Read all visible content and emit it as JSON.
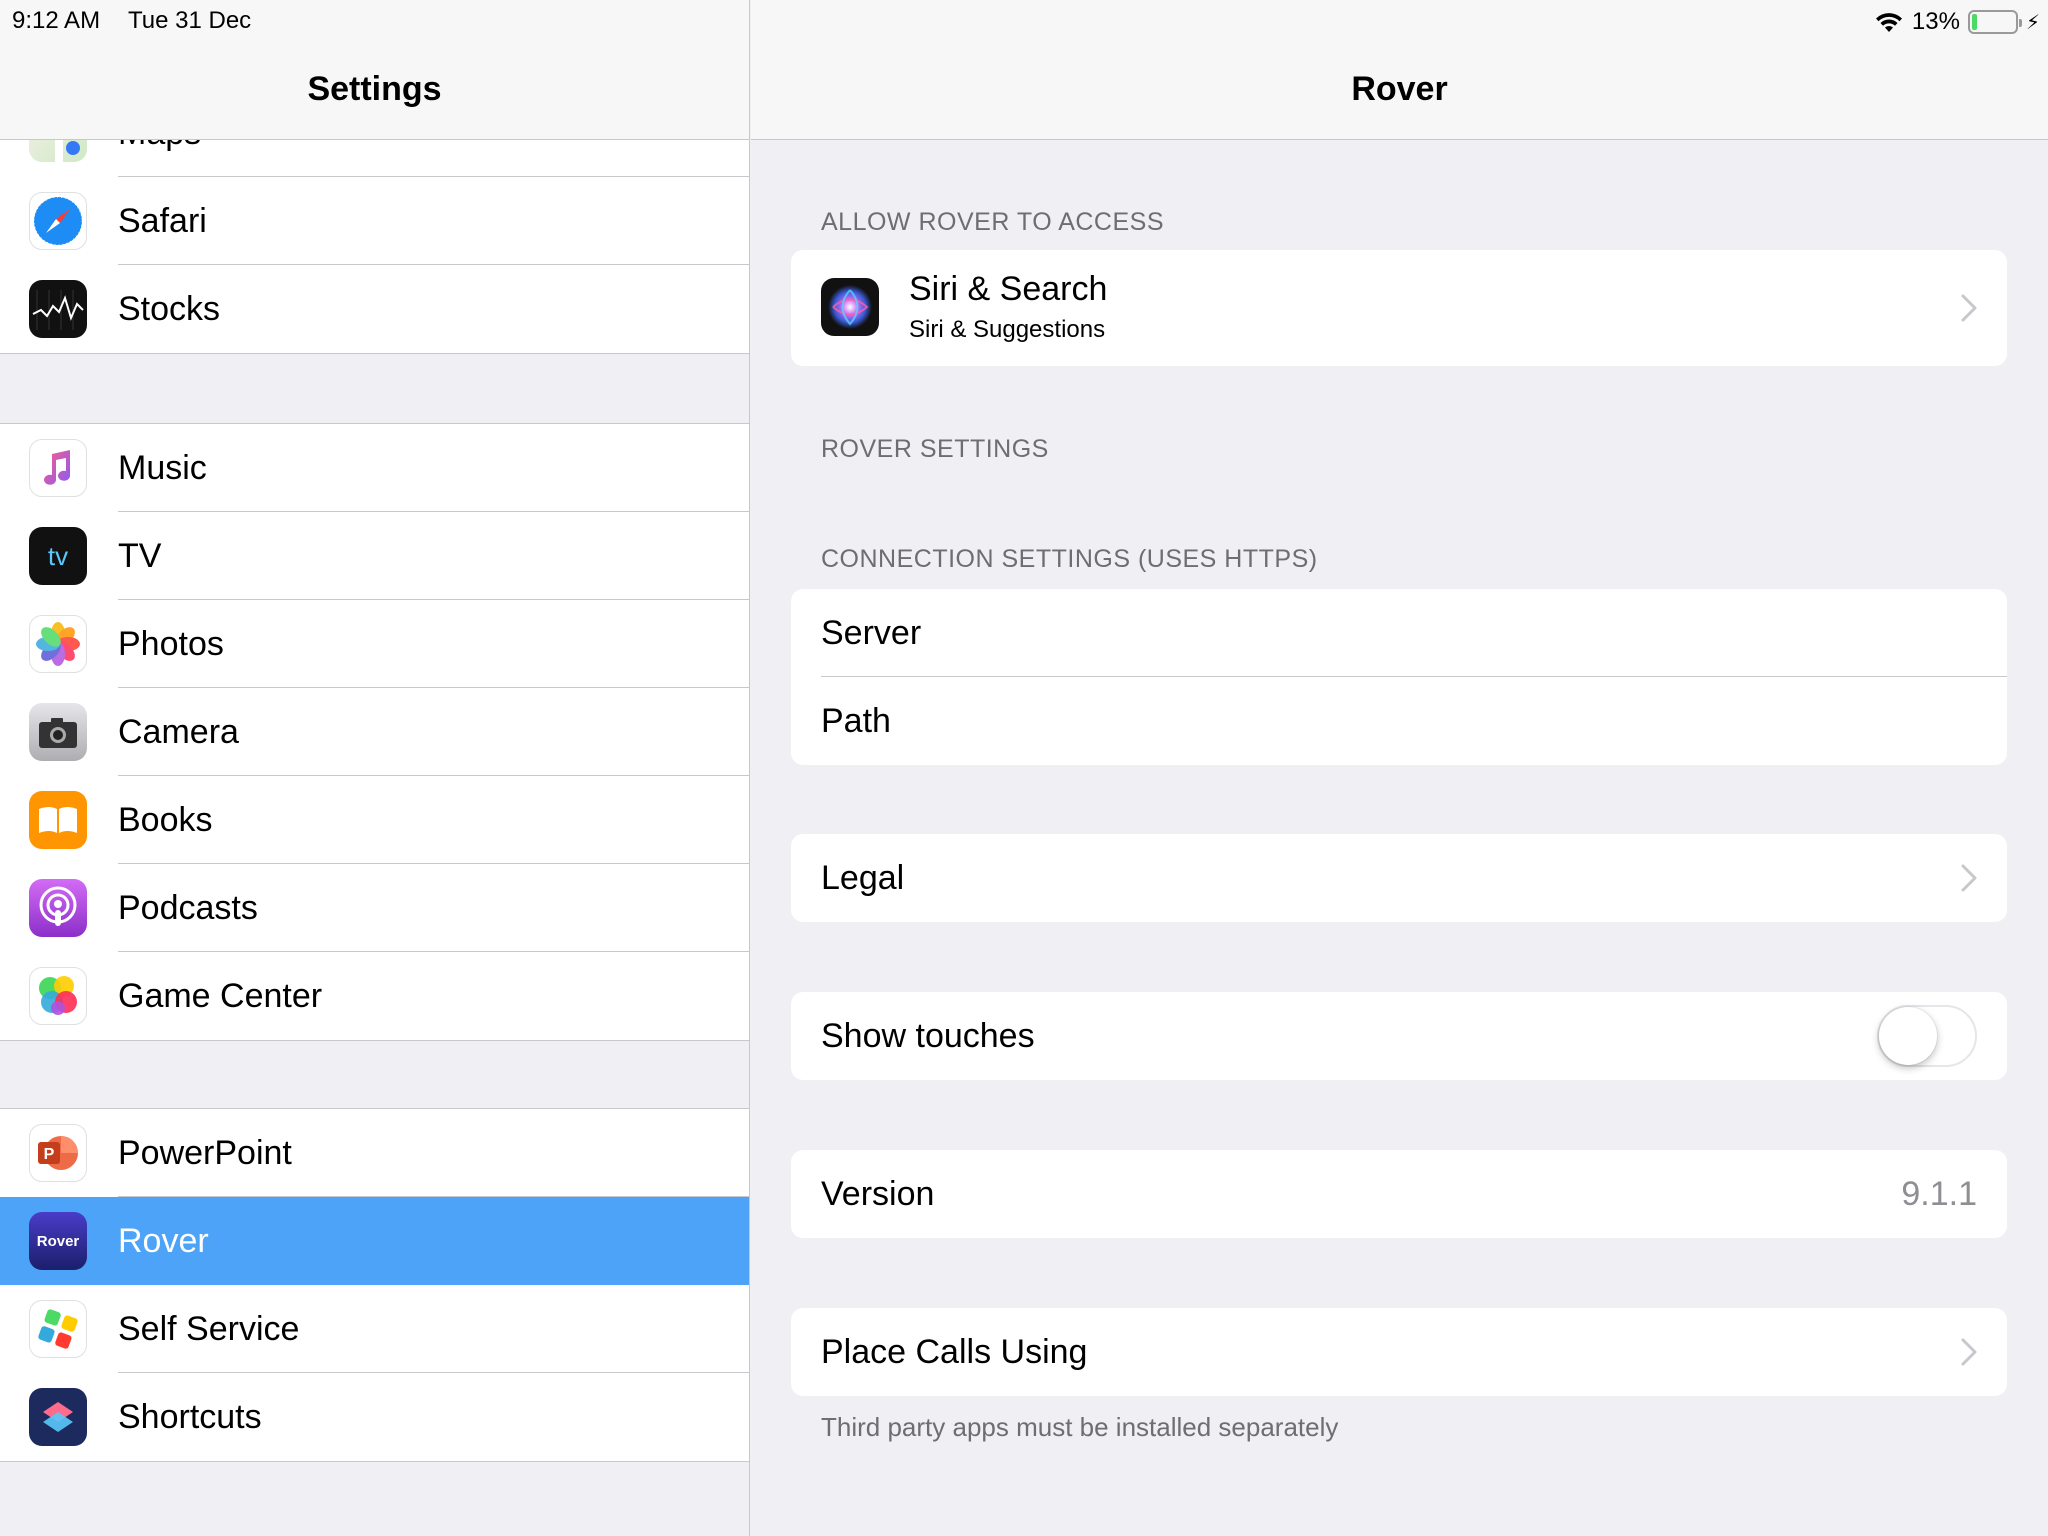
{
  "status_bar": {
    "time": "9:12 AM",
    "date": "Tue 31 Dec",
    "battery_percent": "13%",
    "battery_level": 0.13
  },
  "sidebar": {
    "title": "Settings",
    "partial_item": "Maps",
    "groups": [
      {
        "items": [
          {
            "label": "Safari",
            "icon": "safari-icon"
          },
          {
            "label": "Stocks",
            "icon": "stocks-icon"
          }
        ]
      },
      {
        "items": [
          {
            "label": "Music",
            "icon": "music-icon"
          },
          {
            "label": "TV",
            "icon": "tv-icon"
          },
          {
            "label": "Photos",
            "icon": "photos-icon"
          },
          {
            "label": "Camera",
            "icon": "camera-icon"
          },
          {
            "label": "Books",
            "icon": "books-icon"
          },
          {
            "label": "Podcasts",
            "icon": "podcasts-icon"
          },
          {
            "label": "Game Center",
            "icon": "game-center-icon"
          }
        ]
      },
      {
        "items": [
          {
            "label": "PowerPoint",
            "icon": "powerpoint-icon"
          },
          {
            "label": "Rover",
            "icon": "rover-icon",
            "selected": true
          },
          {
            "label": "Self Service",
            "icon": "self-service-icon"
          },
          {
            "label": "Shortcuts",
            "icon": "shortcuts-icon"
          }
        ]
      }
    ],
    "tv_icon_text": "tv",
    "rover_icon_text": "Rover"
  },
  "detail": {
    "title": "Rover",
    "access_header": "ALLOW ROVER TO ACCESS",
    "siri": {
      "title": "Siri & Search",
      "subtitle": "Siri & Suggestions"
    },
    "rover_settings_header": "ROVER SETTINGS",
    "connection_header": "CONNECTION SETTINGS (USES HTTPS)",
    "server_label": "Server",
    "path_label": "Path",
    "legal_label": "Legal",
    "show_touches_label": "Show touches",
    "show_touches_on": false,
    "version_label": "Version",
    "version_value": "9.1.1",
    "place_calls_label": "Place Calls Using",
    "footer_note": "Third party apps must be installed separately"
  },
  "colors": {
    "selection": "#4da3f7",
    "background": "#efeff4",
    "battery": "#4cd964"
  }
}
